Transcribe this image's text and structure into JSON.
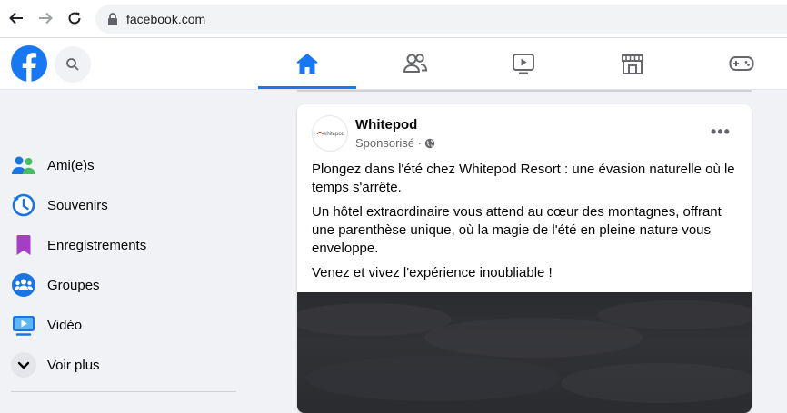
{
  "browser": {
    "url": "facebook.com"
  },
  "topbar": {
    "tabs": [
      {
        "name": "home",
        "icon": "home-icon",
        "active": true
      },
      {
        "name": "friends",
        "icon": "friends-icon",
        "active": false
      },
      {
        "name": "watch",
        "icon": "video-icon",
        "active": false
      },
      {
        "name": "marketplace",
        "icon": "store-icon",
        "active": false
      },
      {
        "name": "gaming",
        "icon": "gamepad-icon",
        "active": false
      }
    ],
    "accent": "#1877f2"
  },
  "sidebar": {
    "items": [
      {
        "label": "Ami(e)s",
        "icon": "friends-icon"
      },
      {
        "label": "Souvenirs",
        "icon": "clock-icon"
      },
      {
        "label": "Enregistrements",
        "icon": "bookmark-icon"
      },
      {
        "label": "Groupes",
        "icon": "groups-icon"
      },
      {
        "label": "Vidéo",
        "icon": "video-icon"
      },
      {
        "label": "Voir plus",
        "icon": "chevron-down-icon"
      }
    ]
  },
  "post": {
    "author": "Whitepod",
    "avatar_text": "whitepod",
    "meta": "Sponsorisé ·",
    "paragraphs": [
      "Plongez dans l'été chez Whitepod Resort : une évasion naturelle où le temps s'arrête.",
      "Un hôtel extraordinaire vous attend au cœur des montagnes, offrant une parenthèse unique, où la magie de l'été en pleine nature vous enveloppe.",
      "Venez et vivez l'expérience inoubliable !"
    ],
    "more": "•••"
  }
}
